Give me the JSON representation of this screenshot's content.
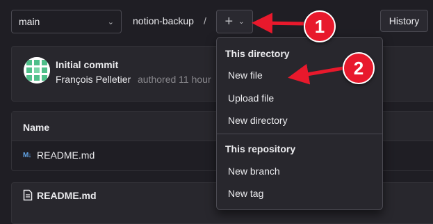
{
  "toolbar": {
    "branch": "main",
    "repo_name": "notion-backup",
    "separator": "/",
    "add_icon": "+",
    "history_label": "History"
  },
  "commit": {
    "title": "Initial commit",
    "author": "François Pelletier",
    "meta": "authored 11 hour"
  },
  "table": {
    "column_name": "Name",
    "rows": [
      {
        "icon": "M↓",
        "name": "README.md"
      }
    ]
  },
  "readme": {
    "title": "README.md"
  },
  "dropdown": {
    "section_directory": "This directory",
    "new_file": "New file",
    "upload_file": "Upload file",
    "new_directory": "New directory",
    "section_repository": "This repository",
    "new_branch": "New branch",
    "new_tag": "New tag"
  },
  "annotations": {
    "badge_1": "1",
    "badge_2": "2"
  },
  "colors": {
    "background": "#1f1e24",
    "panel": "#28272d",
    "annotation_red": "#e8192c",
    "avatar_green": "#4fbf8a"
  },
  "icons": [
    "chevron-down-icon",
    "plus-icon",
    "markdown-icon",
    "document-icon",
    "arrow-icon"
  ]
}
